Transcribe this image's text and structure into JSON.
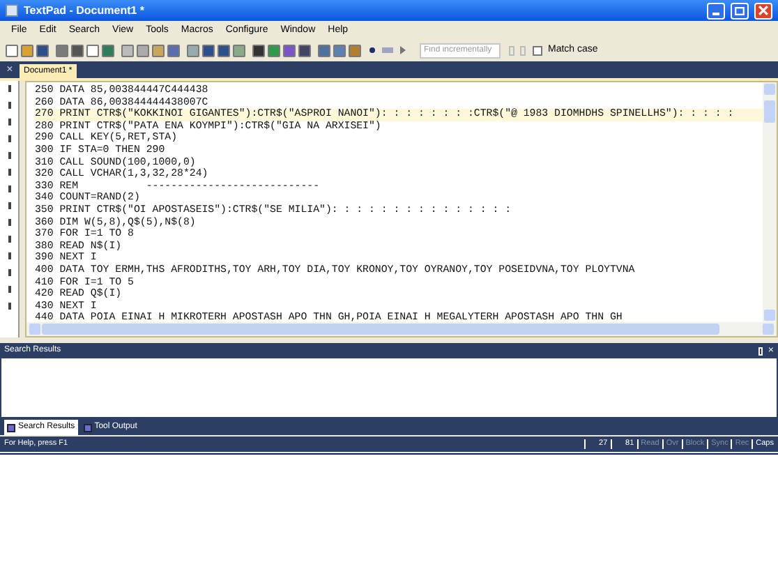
{
  "window": {
    "title": "TextPad - Document1 *"
  },
  "menu": [
    "File",
    "Edit",
    "Search",
    "View",
    "Tools",
    "Macros",
    "Configure",
    "Window",
    "Help"
  ],
  "toolbar": {
    "find_field": {
      "placeholder": "Find incrementally"
    },
    "match_case": {
      "label": "Match case",
      "checked": false
    }
  },
  "document_bar": {
    "close": "×"
  },
  "document_tabs": [
    {
      "label": "Document1 *",
      "selected": true
    }
  ],
  "editor": {
    "lines": [
      {
        "text": "250 DATA 85,003844447C444438",
        "current": false
      },
      {
        "text": "260 DATA 86,003844444438007C",
        "current": false
      },
      {
        "text": "270 PRINT CTR$(\"KOKKINOI GIGANTES\"):CTR$(\"ASPROI NANOI\"): : : : : : : :CTR$(\"@ 1983 DIOMHDHS SPINELLHS\"): : : : :",
        "current": true
      },
      {
        "text": "280 PRINT CTR$(\"PATA ENA KOYMPI\"):CTR$(\"GIA NA ARXISEI\")",
        "current": false
      },
      {
        "text": "290 CALL KEY(5,RET,STA)",
        "current": false
      },
      {
        "text": "300 IF STA=0 THEN 290",
        "current": false
      },
      {
        "text": "310 CALL SOUND(100,1000,0)",
        "current": false
      },
      {
        "text": "320 CALL VCHAR(1,3,32,28*24)",
        "current": false
      },
      {
        "text": "330 REM           ----------------------------",
        "current": false
      },
      {
        "text": "340 COUNT=RAND(2)",
        "current": false
      },
      {
        "text": "350 PRINT CTR$(\"OI APOSTASEIS\"):CTR$(\"SE MILIA\"): : : : : : : : : : : : : : :",
        "current": false
      },
      {
        "text": "360 DIM W(5,8),Q$(5),N$(8)",
        "current": false
      },
      {
        "text": "370 FOR I=1 TO 8",
        "current": false
      },
      {
        "text": "380 READ N$(I)",
        "current": false
      },
      {
        "text": "390 NEXT I",
        "current": false
      },
      {
        "text": "400 DATA TOY ERMH,THS AFRODITHS,TOY ARH,TOY DIA,TOY KRONOY,TOY OYRANOY,TOY POSEIDVNA,TOY PLOYTVNA",
        "current": false
      },
      {
        "text": "410 FOR I=1 TO 5",
        "current": false
      },
      {
        "text": "420 READ Q$(I)",
        "current": false
      },
      {
        "text": "430 NEXT I",
        "current": false
      },
      {
        "text": "440 DATA POIA EINAI H MIKROTERH APOSTASH APO THN GH,POIA EINAI H MEGALYTERH APOSTASH APO THN GH",
        "current": false
      }
    ]
  },
  "output_panel": {
    "title": "Search Results",
    "close": "×"
  },
  "output_tabs": [
    {
      "label": "Search Results",
      "selected": true
    },
    {
      "label": "Tool Output",
      "selected": false
    }
  ],
  "status_bar": {
    "help": "For Help, press F1",
    "line": "27",
    "column": "81",
    "indicators": [
      {
        "label": "Read",
        "on": false
      },
      {
        "label": "Ovr",
        "on": false
      },
      {
        "label": "Block",
        "on": false
      },
      {
        "label": "Sync",
        "on": false
      },
      {
        "label": "Rec",
        "on": false
      },
      {
        "label": "Caps",
        "on": true
      }
    ]
  }
}
